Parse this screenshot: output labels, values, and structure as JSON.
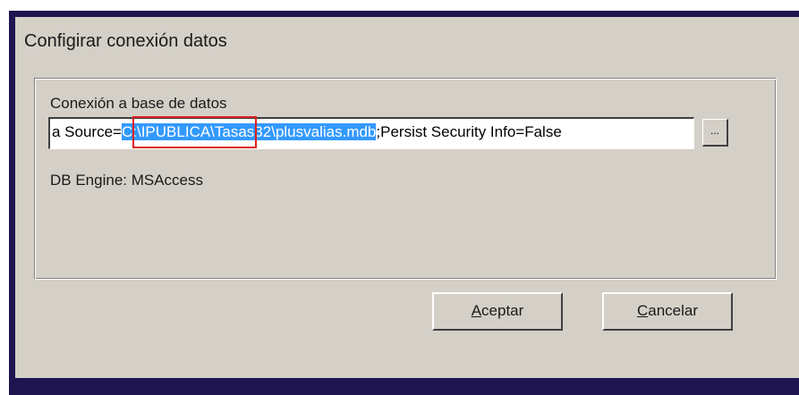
{
  "dialog": {
    "title": "Configirar conexión datos"
  },
  "connection": {
    "label": "Conexión a base de datos",
    "value_before": "a Source=",
    "value_selected": "C:\\IPUBLICA\\Tasas32\\plusvalias.mdb",
    "value_after": ";Persist Security Info=False",
    "browse_label": "..."
  },
  "db_engine": {
    "text": "DB Engine: MSAccess"
  },
  "buttons": {
    "accept_mnemonic": "A",
    "accept_rest": "ceptar",
    "cancel_mnemonic": "C",
    "cancel_rest": "ancelar"
  },
  "colors": {
    "selection": "#3399ff",
    "highlight_box": "#e02020",
    "dialog_face": "#d4d0c8",
    "frame": "#1e1450"
  }
}
